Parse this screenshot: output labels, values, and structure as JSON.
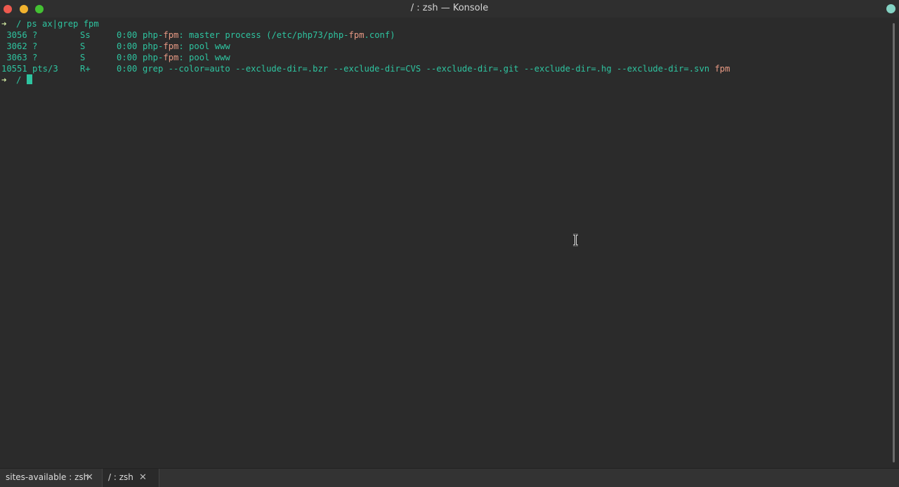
{
  "window": {
    "title": "/ : zsh — Konsole"
  },
  "terminal": {
    "prompt_arrow": "➜",
    "command_line": {
      "cwd": "/",
      "command": "ps ax|grep fpm"
    },
    "rows": [
      {
        "pid": " 3056",
        "tty": "?",
        "stat": "Ss",
        "time": "0:00",
        "cmd_a": "php-",
        "cmd_hl": "fpm",
        "cmd_b": ": master process (/etc/php73/php-",
        "cmd_hl2": "fpm",
        "cmd_c": ".conf)"
      },
      {
        "pid": " 3062",
        "tty": "?",
        "stat": "S",
        "time": "0:00",
        "cmd_a": "php-",
        "cmd_hl": "fpm",
        "cmd_b": ": pool www",
        "cmd_hl2": "",
        "cmd_c": ""
      },
      {
        "pid": " 3063",
        "tty": "?",
        "stat": "S",
        "time": "0:00",
        "cmd_a": "php-",
        "cmd_hl": "fpm",
        "cmd_b": ": pool www",
        "cmd_hl2": "",
        "cmd_c": ""
      },
      {
        "pid": "10551",
        "tty": "pts/3",
        "stat": "R+",
        "time": "0:00",
        "cmd_a": "grep --color=auto --exclude-dir=.bzr --exclude-dir=CVS --exclude-dir=.git --exclude-dir=.hg --exclude-dir=.svn ",
        "cmd_hl": "fpm",
        "cmd_b": "",
        "cmd_hl2": "",
        "cmd_c": ""
      }
    ],
    "current_prompt": {
      "cwd": "/"
    }
  },
  "tabs": [
    {
      "label": "sites-available : zsh",
      "close": "✕"
    },
    {
      "label": "/ : zsh",
      "close": "✕"
    }
  ],
  "colors": {
    "text": "#2ec4a0",
    "highlight": "#e89a84",
    "background": "#2b2b2b"
  }
}
